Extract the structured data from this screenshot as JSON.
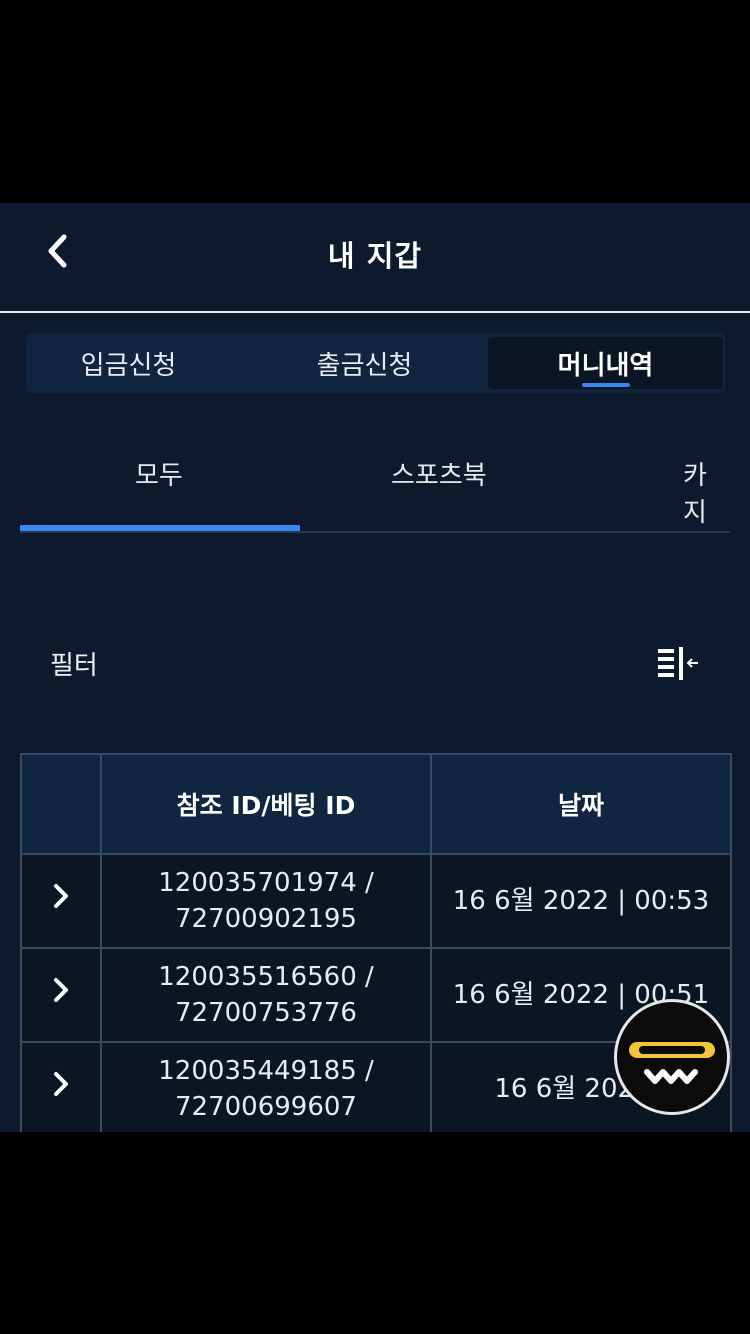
{
  "header": {
    "title": "내 지갑"
  },
  "segments": [
    {
      "label": "입금신청"
    },
    {
      "label": "출금신청"
    },
    {
      "label": "머니내역"
    }
  ],
  "subtabs": [
    {
      "label": "모두"
    },
    {
      "label": "스포츠북"
    },
    {
      "label": "카지"
    }
  ],
  "filter": {
    "label": "필터",
    "icon": "filter-collapse-icon"
  },
  "table": {
    "headers": [
      "",
      "참조 ID/베팅 ID",
      "날짜"
    ],
    "rows": [
      {
        "ref": "120035701974 /",
        "bet": "72700902195",
        "date": "16 6월 2022 | 00:53"
      },
      {
        "ref": "120035516560 /",
        "bet": "72700753776",
        "date": "16 6월 2022 | 00:51"
      },
      {
        "ref": "120035449185 /",
        "bet": "72700699607",
        "date": "16 6월 2022 |"
      }
    ]
  },
  "colors": {
    "accent": "#3a86f2",
    "background": "#0d1a2e",
    "fab_yellow": "#f1c53e"
  }
}
